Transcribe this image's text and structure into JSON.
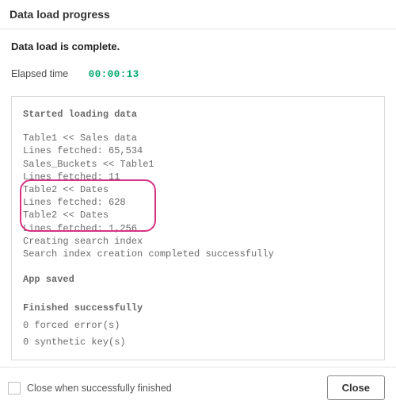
{
  "header": {
    "title": "Data load progress"
  },
  "status": {
    "message": "Data load is complete."
  },
  "elapsed": {
    "label": "Elapsed time",
    "value": "00:00:13"
  },
  "log": {
    "started_heading": "Started loading data",
    "lines": [
      "Table1 << Sales data",
      "Lines fetched: 65,534",
      "Sales_Buckets << Table1",
      "Lines fetched: 11",
      "Table2 << Dates",
      "Lines fetched: 628",
      "Table2 << Dates",
      "Lines fetched: 1,256",
      "Creating search index",
      "Search index creation completed successfully"
    ],
    "app_saved": "App saved",
    "finished_heading": "Finished successfully",
    "forced_errors": "0 forced error(s)",
    "synthetic_keys": "0 synthetic key(s)"
  },
  "footer": {
    "checkbox_label": "Close when successfully finished",
    "close_button": "Close"
  },
  "colors": {
    "elapsed_green": "#00a86b",
    "callout_pink": "#d63384"
  }
}
